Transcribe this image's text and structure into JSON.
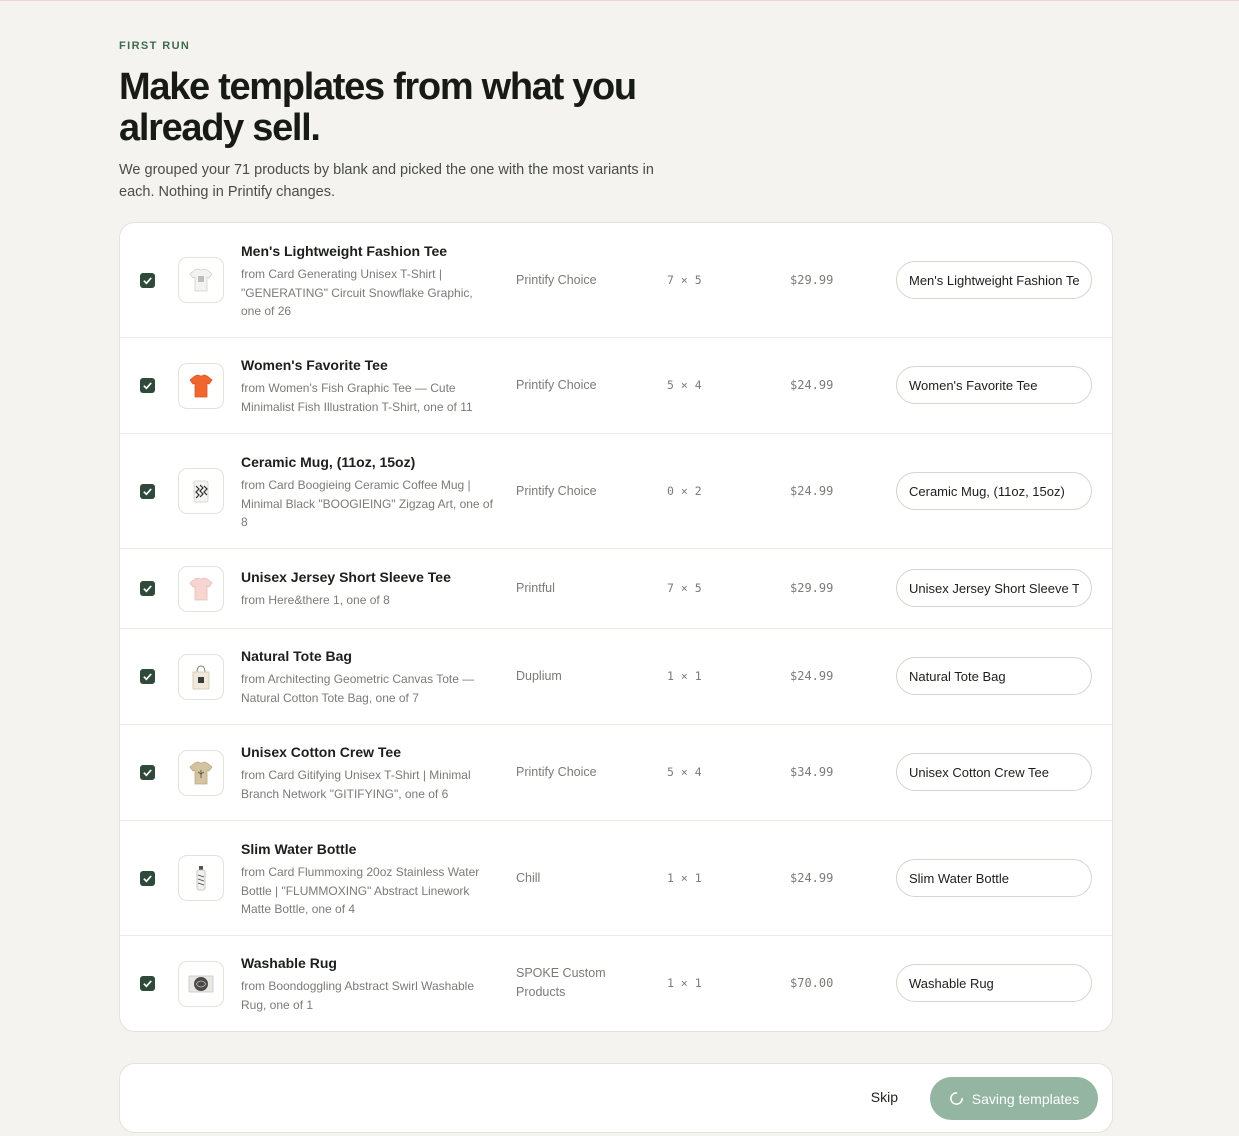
{
  "header": {
    "eyebrow": "FIRST RUN",
    "title": "Make templates from what you already sell.",
    "subtitle": "We grouped your 71 products by blank and picked the one with the most variants in each. Nothing in Printify changes."
  },
  "products": [
    {
      "name": "Men's Lightweight Fashion Tee",
      "from": "from Card Generating Unisex T-Shirt | \"GENERATING\" Circuit Snowflake Graphic, one of 26",
      "provider": "Printify Choice",
      "dims": "7 × 5",
      "price": "$29.99",
      "template_name": "Men's Lightweight Fashion Tee",
      "checked": true,
      "thumb": "white-tshirt-icon"
    },
    {
      "name": "Women's Favorite Tee",
      "from": "from Women's Fish Graphic Tee — Cute Minimalist Fish Illustration T-Shirt, one of 11",
      "provider": "Printify Choice",
      "dims": "5 × 4",
      "price": "$24.99",
      "template_name": "Women's Favorite Tee",
      "checked": true,
      "thumb": "orange-tshirt-icon"
    },
    {
      "name": "Ceramic Mug, (11oz, 15oz)",
      "from": "from Card Boogieing Ceramic Coffee Mug | Minimal Black \"BOOGIEING\" Zigzag Art, one of 8",
      "provider": "Printify Choice",
      "dims": "0 × 2",
      "price": "$24.99",
      "template_name": "Ceramic Mug, (11oz, 15oz)",
      "checked": true,
      "thumb": "mug-icon"
    },
    {
      "name": "Unisex Jersey Short Sleeve Tee",
      "from": "from Here&there 1, one of 8",
      "provider": "Printful",
      "dims": "7 × 5",
      "price": "$29.99",
      "template_name": "Unisex Jersey Short Sleeve Tee",
      "checked": true,
      "thumb": "pink-tshirt-icon"
    },
    {
      "name": "Natural Tote Bag",
      "from": "from Architecting Geometric Canvas Tote — Natural Cotton Tote Bag, one of 7",
      "provider": "Duplium",
      "dims": "1 × 1",
      "price": "$24.99",
      "template_name": "Natural Tote Bag",
      "checked": true,
      "thumb": "tote-bag-icon"
    },
    {
      "name": "Unisex Cotton Crew Tee",
      "from": "from Card Gitifying Unisex T-Shirt | Minimal Branch Network \"GITIFYING\", one of 6",
      "provider": "Printify Choice",
      "dims": "5 × 4",
      "price": "$34.99",
      "template_name": "Unisex Cotton Crew Tee",
      "checked": true,
      "thumb": "tan-tshirt-icon"
    },
    {
      "name": "Slim Water Bottle",
      "from": "from Card Flummoxing 20oz Stainless Water Bottle | \"FLUMMOXING\" Abstract Linework Matte Bottle, one of 4",
      "provider": "Chill",
      "dims": "1 × 1",
      "price": "$24.99",
      "template_name": "Slim Water Bottle",
      "checked": true,
      "thumb": "water-bottle-icon"
    },
    {
      "name": "Washable Rug",
      "from": "from Boondoggling Abstract Swirl Washable Rug, one of 1",
      "provider": "SPOKE Custom Products",
      "dims": "1 × 1",
      "price": "$70.00",
      "template_name": "Washable Rug",
      "checked": true,
      "thumb": "rug-icon"
    }
  ],
  "footer": {
    "skip_label": "Skip",
    "save_label": "Saving templates"
  },
  "colors": {
    "accent": "#2f4a3a",
    "save_button": "#93b5a2",
    "eyebrow": "#3d6b4f",
    "background": "#f4f3ef"
  }
}
